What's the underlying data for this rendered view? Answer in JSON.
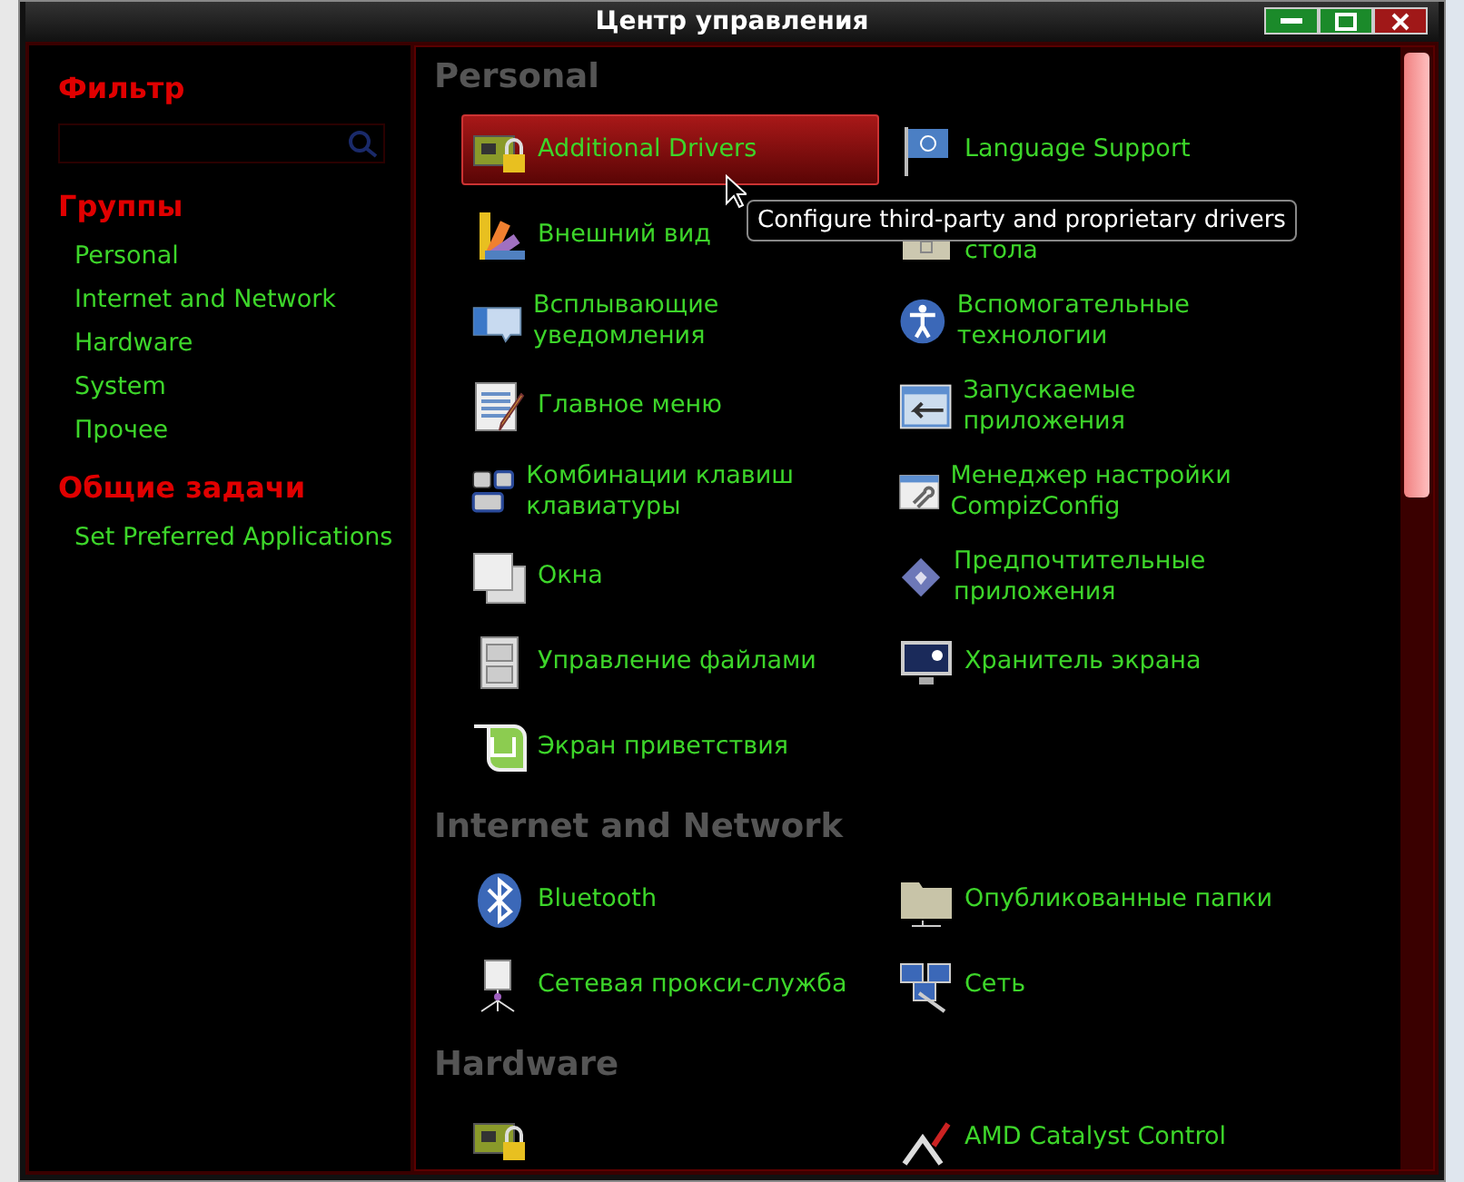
{
  "window": {
    "title": "Центр управления"
  },
  "sidebar": {
    "filter_heading": "Фильтр",
    "groups_heading": "Группы",
    "groups": [
      {
        "label": "Personal"
      },
      {
        "label": "Internet and Network"
      },
      {
        "label": "Hardware"
      },
      {
        "label": "System"
      },
      {
        "label": "Прочее"
      }
    ],
    "tasks_heading": "Общие задачи",
    "tasks": [
      {
        "label": "Set Preferred Applications"
      }
    ]
  },
  "sections": [
    {
      "title": "Personal",
      "items": [
        {
          "kind": "driver",
          "label": "Additional Drivers",
          "selected": true
        },
        {
          "kind": "flag",
          "label": "Language Support",
          "selected": false
        },
        {
          "kind": "palette",
          "label": "Внешний вид",
          "selected": false
        },
        {
          "kind": "desktop",
          "label": "стола",
          "selected": false,
          "covered": true
        },
        {
          "kind": "bubble",
          "label": "Всплывающие уведомления",
          "selected": false
        },
        {
          "kind": "access",
          "label": "Вспомогательные технологии",
          "selected": false
        },
        {
          "kind": "menu",
          "label": "Главное меню",
          "selected": false
        },
        {
          "kind": "startup",
          "label": "Запускаемые приложения",
          "selected": false
        },
        {
          "kind": "keys",
          "label": "Комбинации клавиш клавиатуры",
          "selected": false
        },
        {
          "kind": "wrench",
          "label": "Менеджер настройки CompizConfig",
          "selected": false
        },
        {
          "kind": "windows",
          "label": "Окна",
          "selected": false
        },
        {
          "kind": "diamond",
          "label": "Предпочтительные приложения",
          "selected": false
        },
        {
          "kind": "cabinet",
          "label": "Управление файлами",
          "selected": false
        },
        {
          "kind": "monitor",
          "label": "Хранитель экрана",
          "selected": false
        },
        {
          "kind": "mint",
          "label": "Экран приветствия",
          "selected": false
        }
      ]
    },
    {
      "title": "Internet and Network",
      "items": [
        {
          "kind": "bluetooth",
          "label": "Bluetooth",
          "selected": false
        },
        {
          "kind": "folder",
          "label": "Опубликованные папки",
          "selected": false
        },
        {
          "kind": "proxy",
          "label": "Сетевая прокси-служба",
          "selected": false
        },
        {
          "kind": "network",
          "label": "Сеть",
          "selected": false
        }
      ]
    },
    {
      "title": "Hardware",
      "items": [
        {
          "kind": "driver",
          "selected": false
        },
        {
          "kind": "amd",
          "label": "AMD Catalyst Control",
          "selected": false
        }
      ]
    }
  ],
  "tooltip": "Configure third-party and proprietary drivers"
}
